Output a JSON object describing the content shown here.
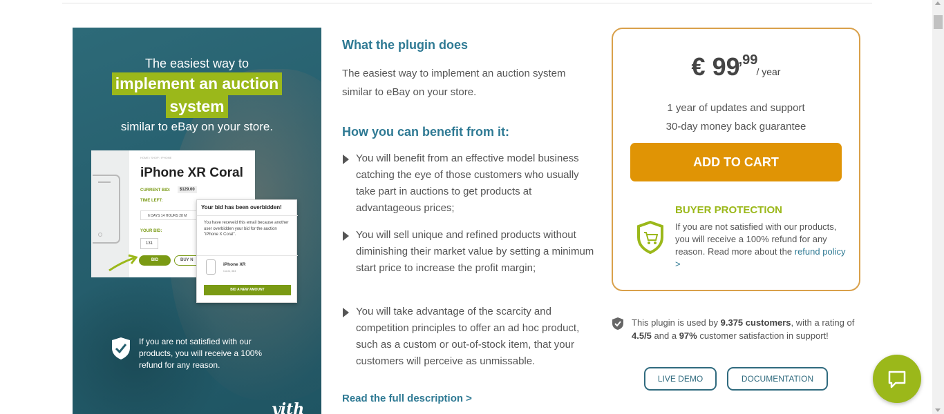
{
  "banner": {
    "line1": "The easiest way to",
    "highlight1": "implement an auction",
    "highlight2": "system",
    "line3": "similar to eBay on your store.",
    "mock": {
      "breadcrumb": "HOME / SHOP / IPHONE",
      "title": "iPhone XR Coral",
      "current_bid_label": "CURRENT BID:",
      "current_bid_value": "$129.00",
      "time_left_label": "TIME LEFT:",
      "time_left_value": "6 DAYS   14 HOURS   28 M",
      "your_bid_label": "YOUR BID:",
      "your_bid_value": "131",
      "bid_button": "BID",
      "buy_now_button": "BUY N"
    },
    "popup": {
      "title": "Your bid has been overbidden!",
      "text": "You have receveid this email because another user overbidden your bid for the auction \"iPhone X Coral\".",
      "item_name": "iPhone XR",
      "item_sub": "Coral, 364",
      "button": "BID A NEW AMOUNT"
    },
    "refund_text": "If you are not satisfied with our products, you will receive a 100% refund for any reason.",
    "logo_text": "yith"
  },
  "description": {
    "what_title": "What the plugin does",
    "what_text": "The easiest way to implement an auction system similar to eBay on your store.",
    "how_title": "How you can benefit from it:",
    "benefits": [
      "You will benefit from an effective model business catching the eye of those customers who usually take part in auctions to get products at advantageous prices;",
      "You will sell unique and refined products without diminishing their market value by setting a minimum start price to increase the profit margin;",
      "You will take advantage of the scarcity and competition principles to offer an ad hoc product, such as a custom or out-of-stock item, that your customers will perceive as unmissable."
    ],
    "read_more": "Read the full description >"
  },
  "pricing": {
    "currency_amount": "€ 99",
    "cents": ",99",
    "period": "/ year",
    "feature1": "1 year of updates and support",
    "feature2": "30-day money back guarantee",
    "add_to_cart": "ADD TO CART",
    "buyer_protection_title": "BUYER PROTECTION",
    "buyer_protection_text": "If you are not satisfied with our products, you will receive a 100% refund for any reason. Read more about the ",
    "buyer_protection_link": "refund policy >"
  },
  "trust": {
    "part1": "This plugin is used by ",
    "customers": "9.375 customers",
    "part2": ", with a rating of ",
    "rating": "4.5/5",
    "part3": " and a ",
    "satisfaction": "97%",
    "part4": " customer satisfaction in support!"
  },
  "buttons": {
    "live_demo": "LIVE DEMO",
    "documentation": "DOCUMENTATION"
  },
  "icons": {
    "chat": "chat-bubble-icon",
    "shield": "shield-check-icon",
    "cart_shield": "shield-cart-icon"
  },
  "colors": {
    "accent_teal": "#2f7a94",
    "accent_green": "#9bb81a",
    "cart_orange": "#e09405",
    "box_border": "#d9a04a"
  }
}
